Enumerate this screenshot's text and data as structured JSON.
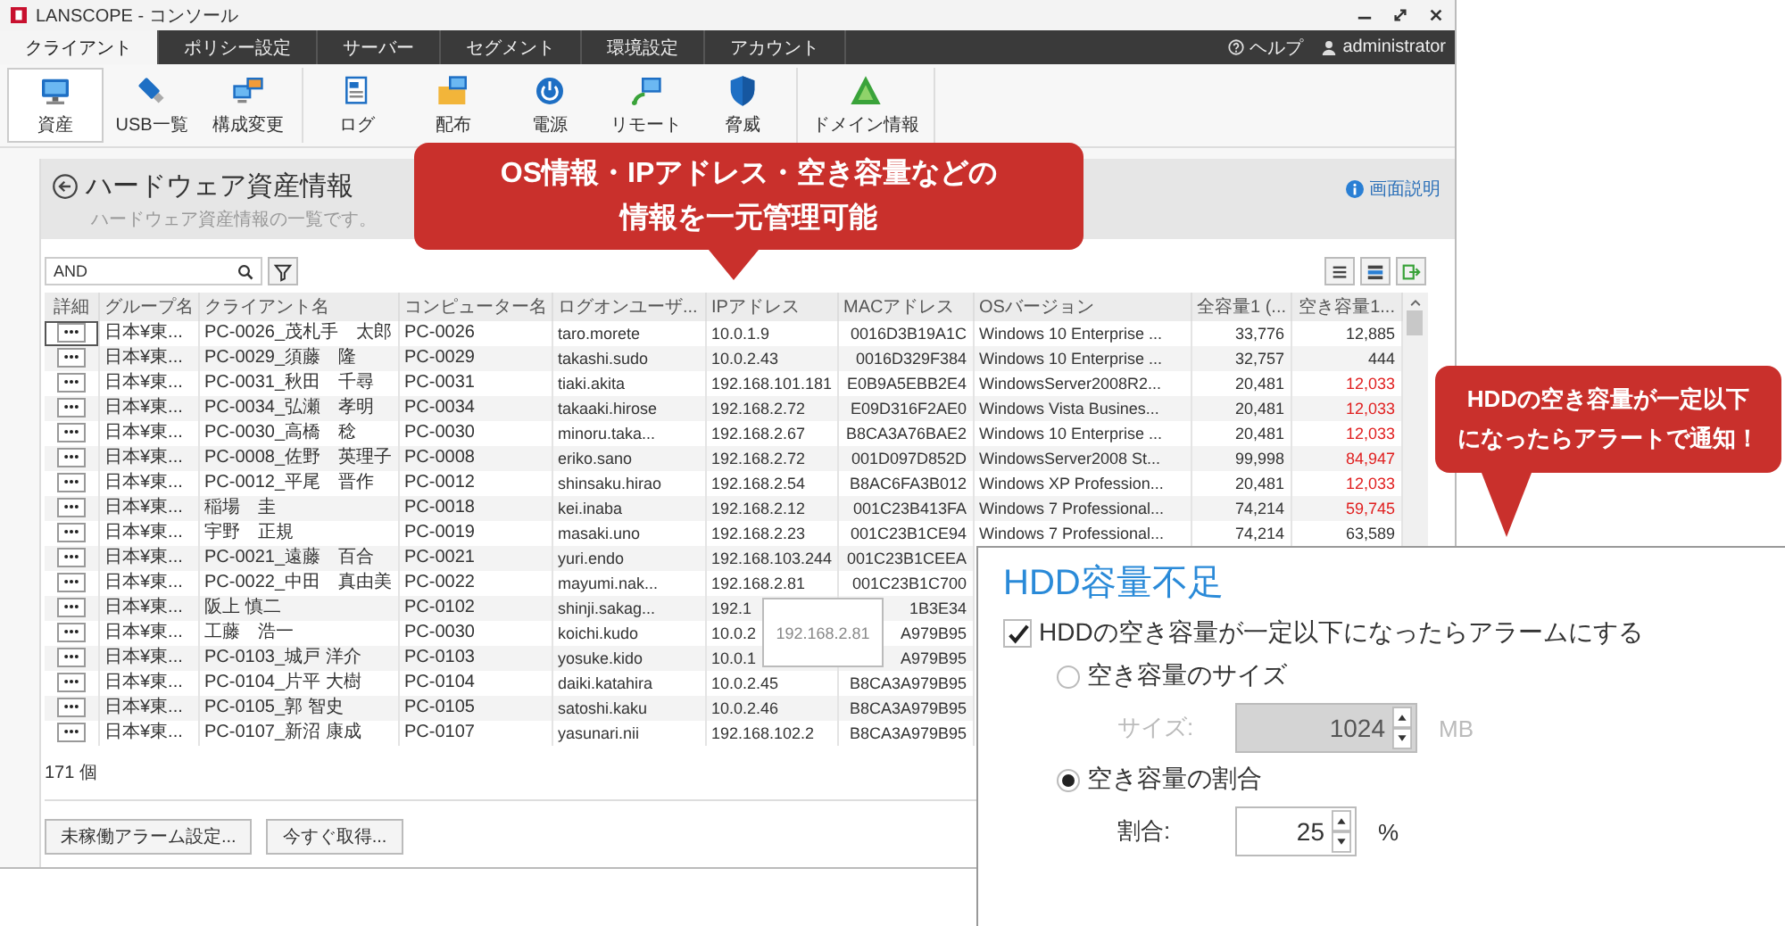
{
  "window": {
    "title": "LANSCOPE - コンソール"
  },
  "tabs": [
    {
      "label": "クライアント",
      "selected": true
    },
    {
      "label": "ポリシー設定",
      "selected": false
    },
    {
      "label": "サーバー",
      "selected": false
    },
    {
      "label": "セグメント",
      "selected": false
    },
    {
      "label": "環境設定",
      "selected": false
    },
    {
      "label": "アカウント",
      "selected": false
    }
  ],
  "header_links": [
    "ヘルプ",
    "administrator"
  ],
  "toolbar": {
    "groups": [
      [
        {
          "label": "資産",
          "selected": true
        },
        {
          "label": "USB一覧",
          "selected": false
        },
        {
          "label": "構成変更",
          "selected": false
        }
      ],
      [
        {
          "label": "ログ",
          "selected": false
        },
        {
          "label": "配布",
          "selected": false
        },
        {
          "label": "電源",
          "selected": false
        },
        {
          "label": "リモート",
          "selected": false
        },
        {
          "label": "脅威",
          "selected": false
        }
      ],
      [
        {
          "label": "ドメイン情報",
          "selected": false
        }
      ]
    ]
  },
  "page": {
    "title": "ハードウェア資産情報",
    "subtitle": "ハードウェア資産情報の一覧です。",
    "help_link": "画面説明"
  },
  "search": {
    "value": "AND"
  },
  "table": {
    "detail_column": "詳細",
    "columns": [
      "グループ名",
      "クライアント名",
      "コンピューター名",
      "ログオンユーザ...",
      "IPアドレス",
      "MACアドレス",
      "OSバージョン",
      "全容量1 (...",
      "空き容量1..."
    ],
    "rows": [
      {
        "selected": true,
        "alert": false,
        "cells": [
          "日本¥東...",
          "PC-0026_茂札手　太郎",
          "PC-0026",
          "taro.morete",
          "10.0.1.9",
          "0016D3B19A1C",
          "Windows 10 Enterprise ...",
          "33,776",
          "12,885"
        ]
      },
      {
        "selected": false,
        "alert": false,
        "cells": [
          "日本¥東...",
          "PC-0029_須藤　隆",
          "PC-0029",
          "takashi.sudo",
          "10.0.2.43",
          "0016D329F384",
          "Windows 10 Enterprise ...",
          "32,757",
          "444"
        ]
      },
      {
        "selected": false,
        "alert": true,
        "cells": [
          "日本¥東...",
          "PC-0031_秋田　千尋",
          "PC-0031",
          "tiaki.akita",
          "192.168.101.181",
          "E0B9A5EBB2E4",
          "WindowsServer2008R2...",
          "20,481",
          "12,033"
        ]
      },
      {
        "selected": false,
        "alert": true,
        "cells": [
          "日本¥東...",
          "PC-0034_弘瀬　孝明",
          "PC-0034",
          "takaaki.hirose",
          "192.168.2.72",
          "E09D316F2AE0",
          "Windows Vista Busines...",
          "20,481",
          "12,033"
        ]
      },
      {
        "selected": false,
        "alert": true,
        "cells": [
          "日本¥東...",
          "PC-0030_高橋　稔",
          "PC-0030",
          "minoru.taka...",
          "192.168.2.67",
          "B8CA3A76BAE2",
          "Windows 10 Enterprise ...",
          "20,481",
          "12,033"
        ]
      },
      {
        "selected": false,
        "alert": true,
        "cells": [
          "日本¥東...",
          "PC-0008_佐野　英理子",
          "PC-0008",
          "eriko.sano",
          "192.168.2.72",
          "001D097D852D",
          "WindowsServer2008 St...",
          "99,998",
          "84,947"
        ]
      },
      {
        "selected": false,
        "alert": true,
        "cells": [
          "日本¥東...",
          "PC-0012_平尾　晋作",
          "PC-0012",
          "shinsaku.hirao",
          "192.168.2.54",
          "B8AC6FA3B012",
          "Windows XP Profession...",
          "20,481",
          "12,033"
        ]
      },
      {
        "selected": false,
        "alert": true,
        "cells": [
          "日本¥東...",
          "稲場　圭",
          "PC-0018",
          "kei.inaba",
          "192.168.2.12",
          "001C23B413FA",
          "Windows 7 Professional...",
          "74,214",
          "59,745"
        ]
      },
      {
        "selected": false,
        "alert": false,
        "cells": [
          "日本¥東...",
          "宇野　正規",
          "PC-0019",
          "masaki.uno",
          "192.168.2.23",
          "001C23B1CE94",
          "Windows 7 Professional...",
          "74,214",
          "63,589"
        ]
      },
      {
        "selected": false,
        "cells": [
          "日本¥東...",
          "PC-0021_遠藤　百合",
          "PC-0021",
          "yuri.endo",
          "192.168.103.244",
          "001C23B1CEEA"
        ]
      },
      {
        "selected": false,
        "cells": [
          "日本¥東...",
          "PC-0022_中田　真由美",
          "PC-0022",
          "mayumi.nak...",
          "192.168.2.81",
          "001C23B1C700"
        ]
      },
      {
        "selected": false,
        "cells": [
          "日本¥東...",
          "阪上 慎二",
          "PC-0102",
          "shinji.sakag...",
          "192.1",
          "1B3E34"
        ]
      },
      {
        "selected": false,
        "cells": [
          "日本¥東...",
          "工藤　浩一",
          "PC-0030",
          "koichi.kudo",
          "10.0.2",
          "A979B95"
        ]
      },
      {
        "selected": false,
        "cells": [
          "日本¥東...",
          "PC-0103_城戸 洋介",
          "PC-0103",
          "yosuke.kido",
          "10.0.1",
          "A979B95"
        ]
      },
      {
        "selected": false,
        "cells": [
          "日本¥東...",
          "PC-0104_片平 大樹",
          "PC-0104",
          "daiki.katahira",
          "10.0.2.45",
          "B8CA3A979B95"
        ]
      },
      {
        "selected": false,
        "cells": [
          "日本¥東...",
          "PC-0105_郭 智史",
          "PC-0105",
          "satoshi.kaku",
          "10.0.2.46",
          "B8CA3A979B95"
        ]
      },
      {
        "selected": false,
        "cells": [
          "日本¥東...",
          "PC-0107_新沼 康成",
          "PC-0107",
          "yasunari.nii",
          "192.168.102.2",
          "B8CA3A979B95"
        ]
      }
    ]
  },
  "tooltip": "192.168.2.81",
  "count": "171 個",
  "buttons": [
    "未稼働アラーム設定...",
    "今すぐ取得..."
  ],
  "callouts": [
    {
      "lines": [
        "OS情報・IPアドレス・空き容量などの",
        "情報を一元管理可能"
      ]
    },
    {
      "lines": [
        "HDDの空き容量が一定以下",
        "になったらアラートで通知！"
      ]
    }
  ],
  "alarm_panel": {
    "title": "HDD容量不足",
    "enable": {
      "label": "HDDの空き容量が一定以下になったらアラームにする",
      "checked": true
    },
    "options": [
      {
        "label": "空き容量のサイズ",
        "selected": false,
        "field_label": "サイズ:",
        "value": "1024",
        "unit": "MB"
      },
      {
        "label": "空き容量の割合",
        "selected": true,
        "field_label": "割合:",
        "value": "25",
        "unit": "%"
      }
    ]
  }
}
